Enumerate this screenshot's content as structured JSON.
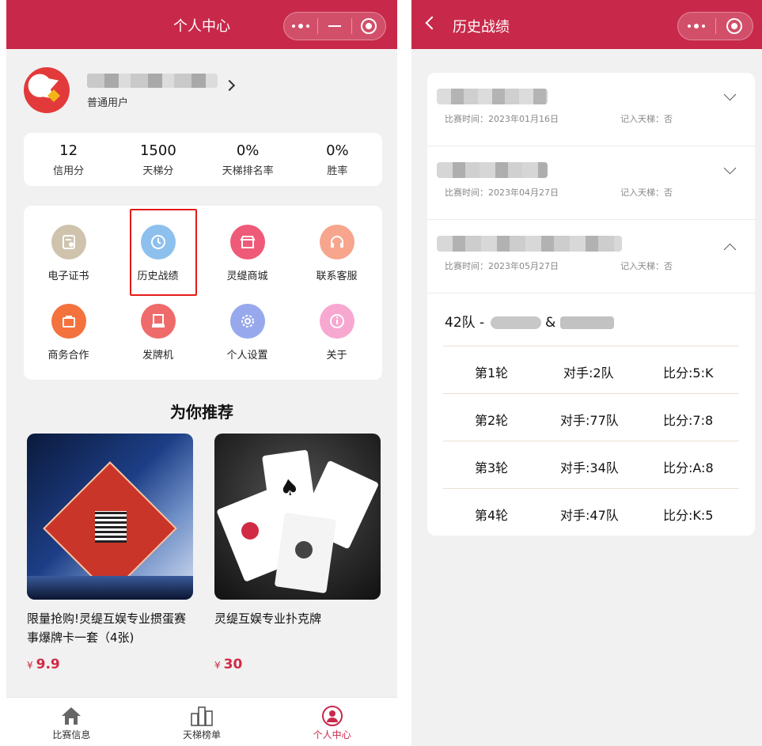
{
  "left": {
    "title": "个人中心",
    "profile": {
      "user_type": "普通用户"
    },
    "stats": [
      {
        "value": "12",
        "label": "信用分"
      },
      {
        "value": "1500",
        "label": "天梯分"
      },
      {
        "value": "0%",
        "label": "天梯排名率"
      },
      {
        "value": "0%",
        "label": "胜率"
      }
    ],
    "menu": [
      {
        "label": "电子证书",
        "icon": "certificate-icon",
        "color": "#cfc3ae"
      },
      {
        "label": "历史战绩",
        "icon": "clock-icon",
        "color": "#8ec0ee"
      },
      {
        "label": "灵缇商城",
        "icon": "store-icon",
        "color": "#ef5a78"
      },
      {
        "label": "联系客服",
        "icon": "headset-icon",
        "color": "#f7a58d"
      },
      {
        "label": "商务合作",
        "icon": "briefcase-icon",
        "color": "#f4723e"
      },
      {
        "label": "发牌机",
        "icon": "machine-icon",
        "color": "#ef6b6b"
      },
      {
        "label": "个人设置",
        "icon": "gear-icon",
        "color": "#97a9ec"
      },
      {
        "label": "关于",
        "icon": "info-icon",
        "color": "#f7a8d1"
      }
    ],
    "recommend_title": "为你推荐",
    "products": [
      {
        "name": "限量抢购!灵缇互娱专业掼蛋赛事爆牌卡一套（4张)",
        "currency": "¥",
        "price": "9.9"
      },
      {
        "name": "灵缇互娱专业扑克牌",
        "currency": "¥",
        "price": "30"
      }
    ],
    "tabs": [
      {
        "label": "比赛信息",
        "icon": "home-icon"
      },
      {
        "label": "天梯榜单",
        "icon": "ranking-icon"
      },
      {
        "label": "个人中心",
        "icon": "user-icon"
      }
    ]
  },
  "right": {
    "title": "历史战绩",
    "matches": [
      {
        "time": "比赛时间：2023年01月16日",
        "ladder": "记入天梯：否",
        "expanded": false
      },
      {
        "time": "比赛时间：2023年04月27日",
        "ladder": "记入天梯：否",
        "expanded": false
      },
      {
        "time": "比赛时间：2023年05月27日",
        "ladder": "记入天梯：否",
        "expanded": true
      }
    ],
    "detail": {
      "team_prefix": "42队 -",
      "amp": "&",
      "rounds": [
        {
          "round": "第1轮",
          "opponent": "对手:2队",
          "score": "比分:5:K"
        },
        {
          "round": "第2轮",
          "opponent": "对手:77队",
          "score": "比分:7:8"
        },
        {
          "round": "第3轮",
          "opponent": "对手:34队",
          "score": "比分:A:8"
        },
        {
          "round": "第4轮",
          "opponent": "对手:47队",
          "score": "比分:K:5"
        }
      ]
    }
  }
}
